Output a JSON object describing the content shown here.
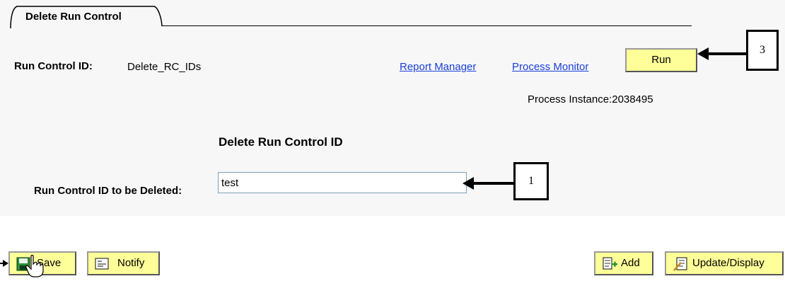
{
  "tab": {
    "label": "Delete Run Control"
  },
  "run_control": {
    "label": "Run Control ID:",
    "value": "Delete_RC_IDs"
  },
  "links": {
    "report_manager": "Report Manager",
    "process_monitor": "Process Monitor"
  },
  "run_button": {
    "label": "Run"
  },
  "process_instance": {
    "text": "Process Instance:2038495"
  },
  "section": {
    "title": "Delete Run Control ID"
  },
  "delete_field": {
    "label": "Run Control ID to be Deleted:",
    "value": "test"
  },
  "callouts": {
    "one": "1",
    "three": "3"
  },
  "toolbar": {
    "save_label": "Save",
    "notify_label": "Notify",
    "add_label": "Add",
    "update_label": "Update/Display"
  },
  "colors": {
    "button_bg": "#ffff99",
    "link": "#1a3fd9"
  }
}
